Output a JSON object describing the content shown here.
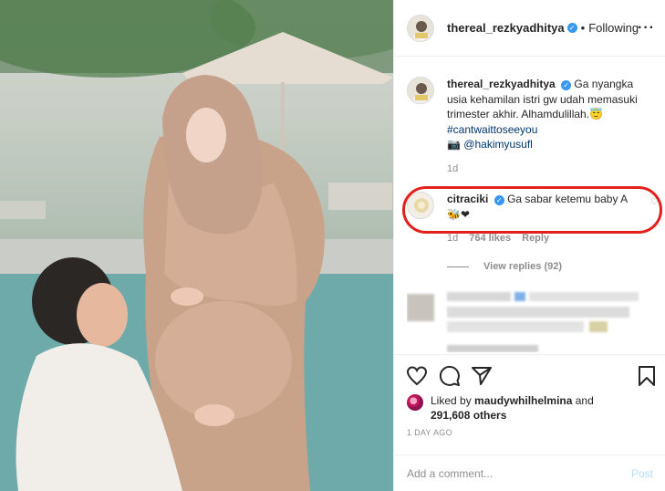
{
  "post": {
    "author": "thereal_rezkyadhitya",
    "verified_mark": "✓",
    "separator": "•",
    "follow_state": "Following",
    "more_label": "···"
  },
  "caption": {
    "username": "thereal_rezkyadhitya",
    "text_line": "Ga nyangka usia kehamilan istri gw udah memasuki trimester akhir. Alhamdulillah.",
    "emoji": "😇",
    "hashtag": "#cantwaittoseeyou",
    "camera": "📷",
    "mention": "@hakimyusufl",
    "time": "1d"
  },
  "comment": {
    "username": "citraciki",
    "text": "Ga sabar ketemu baby A",
    "emojis": "🐝❤",
    "time": "1d",
    "likes": "764 likes",
    "reply_label": "Reply",
    "heart": "♡"
  },
  "view_replies": "View replies (92)",
  "likes": {
    "prefix": "Liked by",
    "by_user": "maudywhilhelmina",
    "and": "and",
    "others": "291,608 others"
  },
  "posted_ago": "1 DAY AGO",
  "add_comment": {
    "placeholder": "Add a comment...",
    "post_label": "Post"
  },
  "icons": [
    "heart-icon",
    "comment-icon",
    "share-icon",
    "bookmark-icon"
  ],
  "colors": {
    "highlight": "#e2201c",
    "verified": "#3897f0",
    "post_disabled": "#b2dffc"
  }
}
